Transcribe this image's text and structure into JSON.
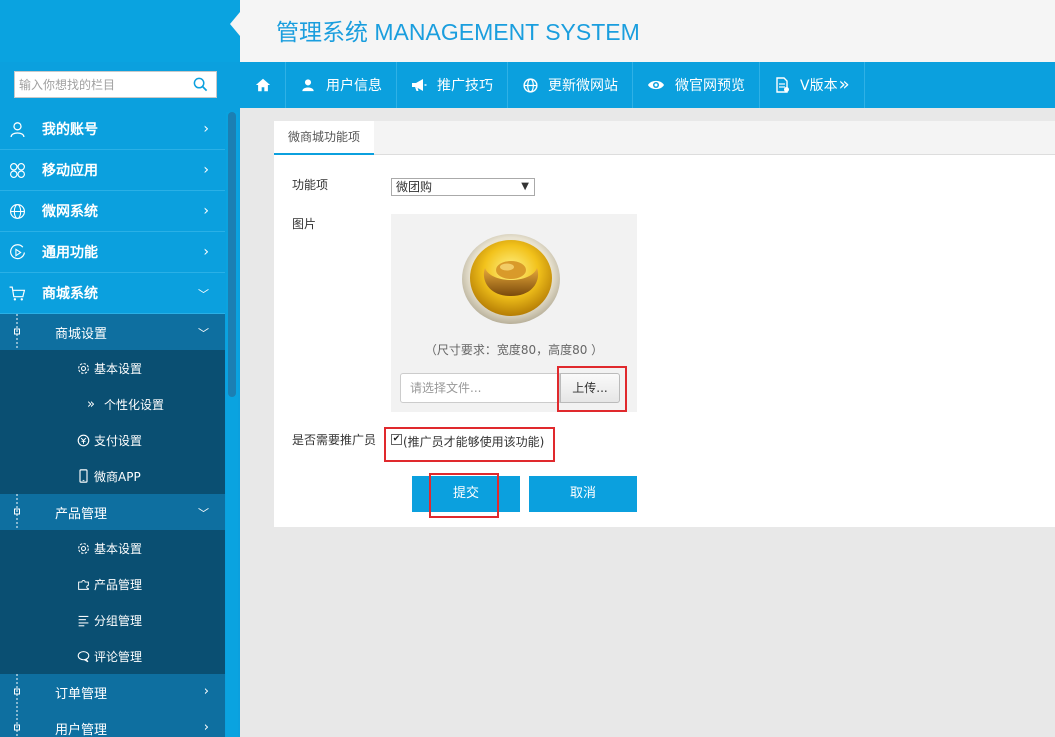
{
  "header": {
    "title": "管理系统 MANAGEMENT SYSTEM"
  },
  "search": {
    "placeholder": "输入你想找的栏目"
  },
  "sidebar": {
    "menu": [
      {
        "label": "我的账号",
        "icon": "user-icon"
      },
      {
        "label": "移动应用",
        "icon": "apps-icon"
      },
      {
        "label": "微网系统",
        "icon": "globe-icon"
      },
      {
        "label": "通用功能",
        "icon": "play-icon"
      },
      {
        "label": "商城系统",
        "icon": "cart-icon"
      }
    ],
    "mall_settings": {
      "label": "商城设置"
    },
    "mall_settings_items": [
      {
        "label": "基本设置",
        "icon": "gear-icon"
      },
      {
        "label": "个性化设置",
        "icon": "double-chevron-icon"
      },
      {
        "label": "支付设置",
        "icon": "pay-icon"
      },
      {
        "label": "微商APP",
        "icon": "phone-icon"
      }
    ],
    "product_mgmt": {
      "label": "产品管理"
    },
    "product_items": [
      {
        "label": "基本设置",
        "icon": "gear-icon"
      },
      {
        "label": "产品管理",
        "icon": "puzzle-icon"
      },
      {
        "label": "分组管理",
        "icon": "list-icon"
      },
      {
        "label": "评论管理",
        "icon": "comment-icon"
      }
    ],
    "order_mgmt": {
      "label": "订单管理"
    },
    "user_mgmt": {
      "label": "用户管理"
    }
  },
  "topnav": [
    {
      "label": "",
      "icon": "home-icon"
    },
    {
      "label": "用户信息",
      "icon": "person-icon"
    },
    {
      "label": "推广技巧",
      "icon": "megaphone-icon"
    },
    {
      "label": "更新微网站",
      "icon": "globe-icon"
    },
    {
      "label": "微官网预览",
      "icon": "eye-icon"
    },
    {
      "label": "V版本",
      "icon": "doc-icon"
    }
  ],
  "panel": {
    "tab": "微商城功能项",
    "feature_label": "功能项",
    "feature_value": "微团购",
    "image_label": "图片",
    "size_hint": "（尺寸要求：宽度80，高度80 ）",
    "file_placeholder": "请选择文件...",
    "upload_label": "上传...",
    "promoter_label": "是否需要推广员",
    "promoter_checked": true,
    "promoter_note": "(推广员才能够使用该功能)",
    "submit_label": "提交",
    "cancel_label": "取消"
  },
  "colors": {
    "primary": "#0ba0de",
    "dark_sub": "#0a4f72",
    "mid_sub": "#0e6fa0",
    "highlight": "#e0292d"
  }
}
